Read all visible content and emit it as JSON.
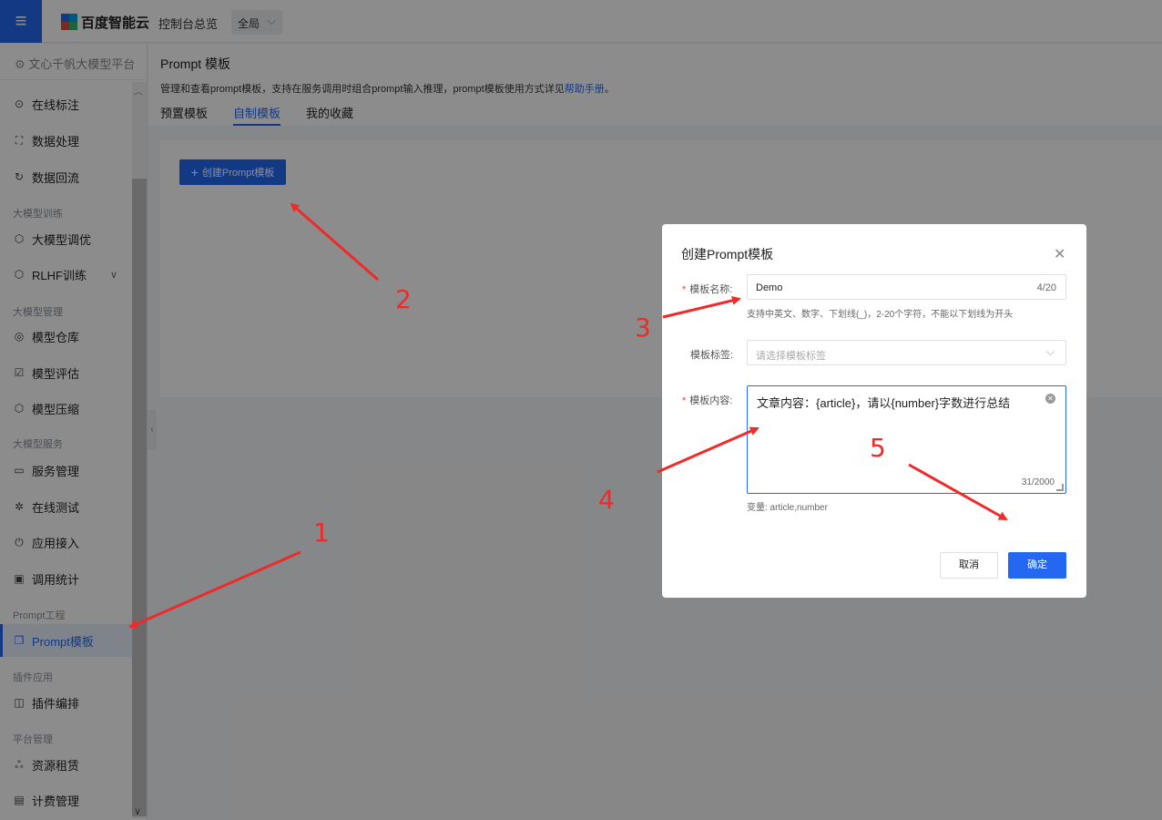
{
  "topbar": {
    "menu_icon": "≡",
    "brand": "百度智能云",
    "console": "控制台总览",
    "region": "全局"
  },
  "sidebar": {
    "header": "文心千帆大模型平台",
    "items": [
      {
        "label": "在线标注",
        "icon": "annotate-icon"
      },
      {
        "label": "数据处理",
        "icon": "data-process-icon"
      },
      {
        "label": "数据回流",
        "icon": "data-reflow-icon"
      },
      {
        "label": "大模型调优",
        "icon": "tune-icon"
      },
      {
        "label": "RLHF训练",
        "icon": "rlhf-icon"
      },
      {
        "label": "模型仓库",
        "icon": "model-repo-icon"
      },
      {
        "label": "模型评估",
        "icon": "evaluate-icon"
      },
      {
        "label": "模型压缩",
        "icon": "compress-icon"
      },
      {
        "label": "服务管理",
        "icon": "service-icon"
      },
      {
        "label": "在线测试",
        "icon": "test-icon"
      },
      {
        "label": "应用接入",
        "icon": "app-access-icon"
      },
      {
        "label": "调用统计",
        "icon": "stats-icon"
      },
      {
        "label": "Prompt模板",
        "icon": "prompt-icon"
      },
      {
        "label": "插件编排",
        "icon": "plugin-icon"
      },
      {
        "label": "资源租赁",
        "icon": "resource-icon"
      },
      {
        "label": "计费管理",
        "icon": "billing-icon"
      }
    ],
    "groups": [
      "大模型训练",
      "大模型管理",
      "大模型服务",
      "Prompt工程",
      "插件应用",
      "平台管理"
    ]
  },
  "page": {
    "title": "Prompt 模板",
    "description": "管理和查看prompt模板，支持在服务调用时组合prompt输入推理，prompt模板使用方式详见",
    "help_link": "帮助手册",
    "desc_end": "。",
    "tabs": [
      "预置模板",
      "自制模板",
      "我的收藏"
    ],
    "create_button": "创建Prompt模板"
  },
  "modal": {
    "title": "创建Prompt模板",
    "name_label": "模板名称:",
    "name_value": "Demo",
    "name_count": "4/20",
    "name_hint": "支持中英文、数字、下划线(_)，2-20个字符，不能以下划线为开头",
    "tag_label": "模板标签:",
    "tag_placeholder": "请选择模板标签",
    "content_label": "模板内容:",
    "content_value": "文章内容：{article}，请以{number}字数进行总结",
    "content_count": "31/2000",
    "variables": "变量:  article,number",
    "cancel": "取消",
    "confirm": "确定"
  },
  "annotations": [
    "1",
    "2",
    "3",
    "4",
    "5"
  ],
  "colors": {
    "primary": "#2468f2",
    "annotation": "#ee2a2a"
  }
}
